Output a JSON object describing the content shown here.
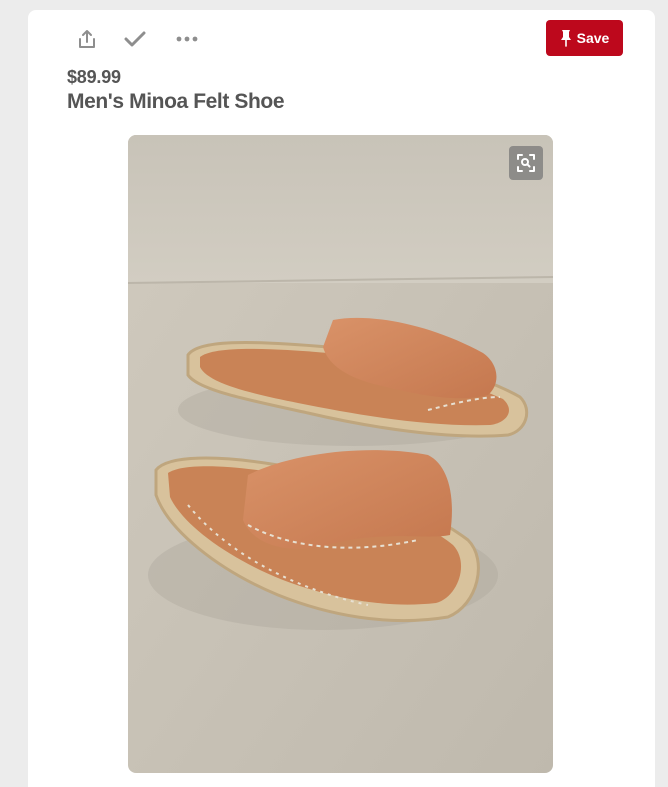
{
  "toolbar": {
    "icons": [
      "share-icon",
      "check-icon",
      "more-icon"
    ],
    "save_label": "Save"
  },
  "product": {
    "price": "$89.99",
    "title": "Men's Minoa Felt Shoe"
  },
  "image": {
    "subject": "orange suede espadrille slide sandals",
    "zoom_icon": "visual-search-icon"
  },
  "colors": {
    "save_button": "#bd081c",
    "text": "#555555",
    "page_background": "#ececec"
  }
}
